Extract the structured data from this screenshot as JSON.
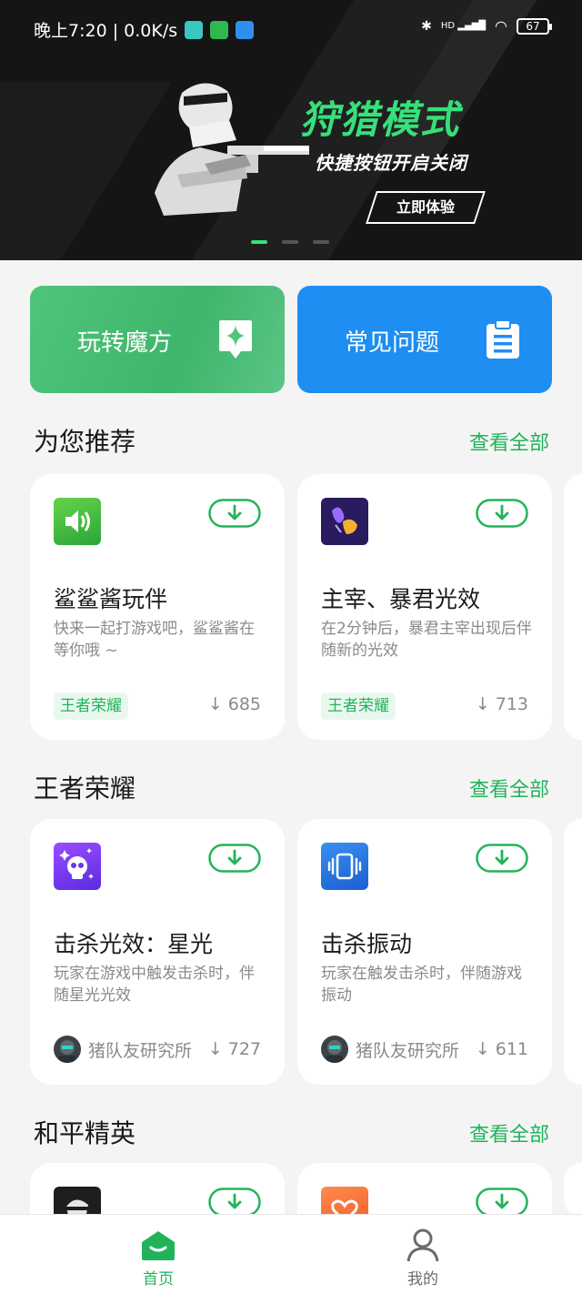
{
  "status_bar": {
    "time_speed": "晚上7:20 | 0.0K/s",
    "battery": "67",
    "network": "HD"
  },
  "banner": {
    "title": "狩猎模式",
    "subtitle": "快捷按钮开启关闭",
    "button": "立即体验",
    "page_count": 3,
    "active_page": 1
  },
  "tiles": [
    {
      "label": "玩转魔方",
      "icon": "sparkle-bubble-icon",
      "color": "#4fc57a"
    },
    {
      "label": "常见问题",
      "icon": "clipboard-icon",
      "color": "#1e8ef2"
    }
  ],
  "sections": [
    {
      "title": "为您推荐",
      "more": "查看全部",
      "cards": [
        {
          "name": "鲨鲨酱玩伴",
          "desc": "快来一起打游戏吧，鲨鲨酱在等你哦 ~",
          "tag": "王者荣耀",
          "downloads": "685",
          "icon": "speaker-icon"
        },
        {
          "name": "主宰、暴君光效",
          "desc": "在2分钟后，暴君主宰出现后伴随新的光效",
          "tag": "王者荣耀",
          "downloads": "713",
          "icon": "dragon-icon"
        }
      ]
    },
    {
      "title": "王者荣耀",
      "more": "查看全部",
      "cards": [
        {
          "name": "击杀光效：星光",
          "desc": "玩家在游戏中触发击杀时，伴随星光光效",
          "author": "猪队友研究所",
          "downloads": "727",
          "icon": "skull-icon"
        },
        {
          "name": "击杀振动",
          "desc": "玩家在触发击杀时，伴随游戏振动",
          "author": "猪队友研究所",
          "downloads": "611",
          "icon": "vibrate-icon"
        }
      ]
    },
    {
      "title": "和平精英",
      "more": "查看全部"
    }
  ],
  "nav": {
    "home": "首页",
    "me": "我的"
  },
  "colors": {
    "accent": "#22b35a",
    "banner_title": "#36e07a",
    "blue_tile": "#1e8ef2"
  }
}
